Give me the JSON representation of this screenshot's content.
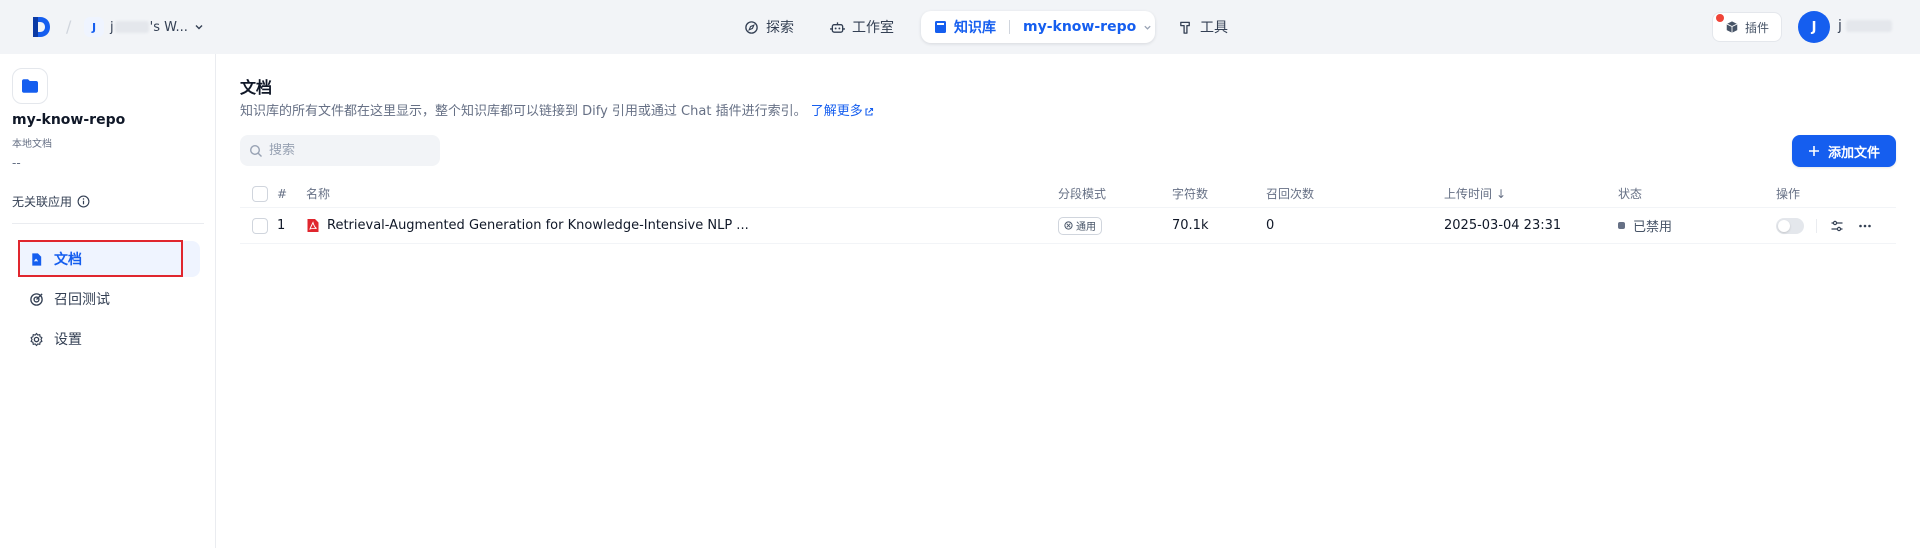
{
  "topbar": {
    "workspace": {
      "avatar_letter": "J",
      "name_start": "j",
      "name_end": "'s W..."
    },
    "nav": {
      "explore": "探索",
      "studio": "工作室",
      "knowledge": "知识库",
      "current_repo": "my-know-repo",
      "tools": "工具"
    },
    "plugins_label": "插件",
    "user": {
      "avatar_letter": "J",
      "name_start": "j"
    }
  },
  "sidebar": {
    "repo_name": "my-know-repo",
    "repo_type": "本地文档",
    "repo_desc": "--",
    "no_app": "无关联应用",
    "items": [
      {
        "label": "文档",
        "icon": "document-icon",
        "active": true
      },
      {
        "label": "召回测试",
        "icon": "target-icon",
        "active": false
      },
      {
        "label": "设置",
        "icon": "gear-icon",
        "active": false
      }
    ]
  },
  "main": {
    "title": "文档",
    "subtitle": "知识库的所有文件都在这里显示，整个知识库都可以链接到 Dify 引用或通过 Chat 插件进行索引。",
    "learn_more": "了解更多",
    "search_placeholder": "搜索",
    "add_button": "添加文件",
    "columns": {
      "index": "#",
      "name": "名称",
      "mode": "分段模式",
      "chars": "字符数",
      "recall": "召回次数",
      "upload_time": "上传时间",
      "sort_arrow": "↓",
      "status": "状态",
      "ops": "操作"
    },
    "rows": [
      {
        "index": "1",
        "name": "Retrieval-Augmented Generation for Knowledge-Intensive NLP ...",
        "file_type": "pdf-icon",
        "mode": "通用",
        "chars": "70.1k",
        "recall": "0",
        "upload_time": "2025-03-04 23:31",
        "status": "已禁用",
        "enabled": false
      }
    ]
  },
  "colors": {
    "accent": "#155eef",
    "highlight": "#e0262e",
    "pdf": "#e0262e"
  }
}
